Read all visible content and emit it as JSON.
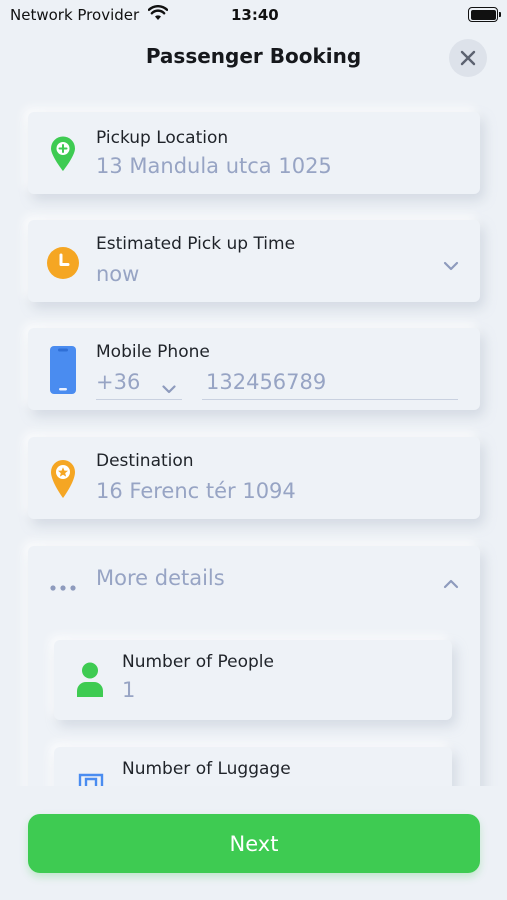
{
  "status_bar": {
    "carrier": "Network Provider",
    "time": "13:40"
  },
  "header": {
    "title": "Passenger Booking"
  },
  "pickup": {
    "label": "Pickup Location",
    "value": "13 Mandula utca 1025"
  },
  "pickup_time": {
    "label": "Estimated Pick up Time",
    "value": "now"
  },
  "phone": {
    "label": "Mobile Phone",
    "country_code": "+36",
    "number": "132456789"
  },
  "destination": {
    "label": "Destination",
    "value": "16 Ferenc tér 1094"
  },
  "more_details": {
    "label": "More details",
    "people": {
      "label": "Number of People",
      "value": "1"
    },
    "luggage": {
      "label": "Number of Luggage"
    }
  },
  "footer": {
    "next_label": "Next"
  },
  "colors": {
    "accent_green": "#3ecb52",
    "orange": "#f5a623",
    "blue": "#4a8cf0",
    "placeholder": "#97a4c4"
  }
}
